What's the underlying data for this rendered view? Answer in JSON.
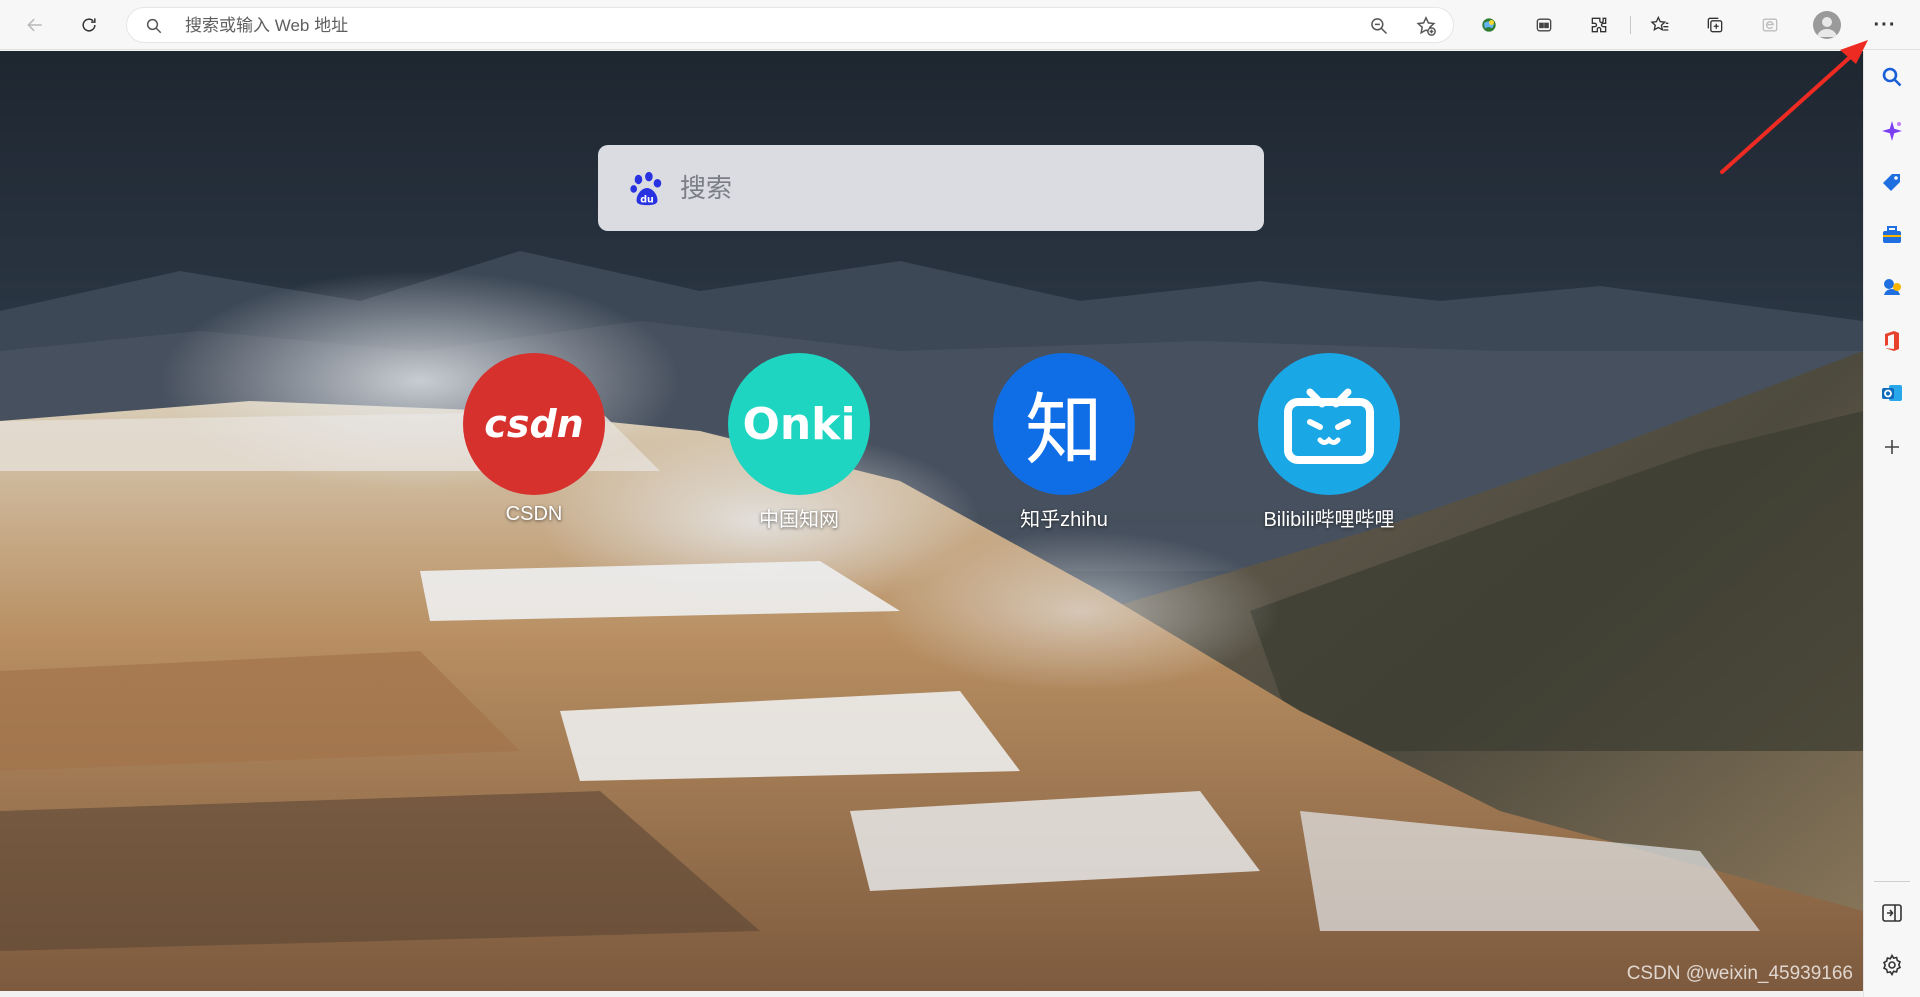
{
  "browser": {
    "address_placeholder": "搜索或输入 Web 地址",
    "icons": [
      "back-arrow-icon",
      "refresh-icon",
      "search-icon",
      "zoom-icon",
      "add-favorite-icon",
      "browser-essentials-icon",
      "workspaces-icon",
      "extensions-icon",
      "favorites-icon",
      "collections-icon",
      "ie-mode-icon",
      "profile-avatar",
      "more-menu-icon"
    ],
    "more_label": "···"
  },
  "page": {
    "search_placeholder": "搜索",
    "shortcuts": [
      {
        "label": "CSDN",
        "color": "#d7312e",
        "logo_text": "csdn"
      },
      {
        "label": "中国知网",
        "color": "#1dd5c1",
        "logo_text": "Onki"
      },
      {
        "label": "知乎zhihu",
        "color": "#0f6ee6",
        "logo_text": "知"
      },
      {
        "label": "Bilibili哔哩哔哩",
        "color": "#1aa7e6",
        "logo_text": ""
      }
    ],
    "watermark": "CSDN @weixin_45939166"
  },
  "sidebar": {
    "icons": [
      "search-icon",
      "copilot-icon",
      "shopping-icon",
      "tools-icon",
      "games-icon",
      "office-icon",
      "outlook-icon",
      "add-icon",
      "split-screen-icon",
      "settings-icon"
    ]
  },
  "colors": {
    "accent_red_arrow": "#ee2b22",
    "toolbar_bg": "#f7f7f7"
  }
}
